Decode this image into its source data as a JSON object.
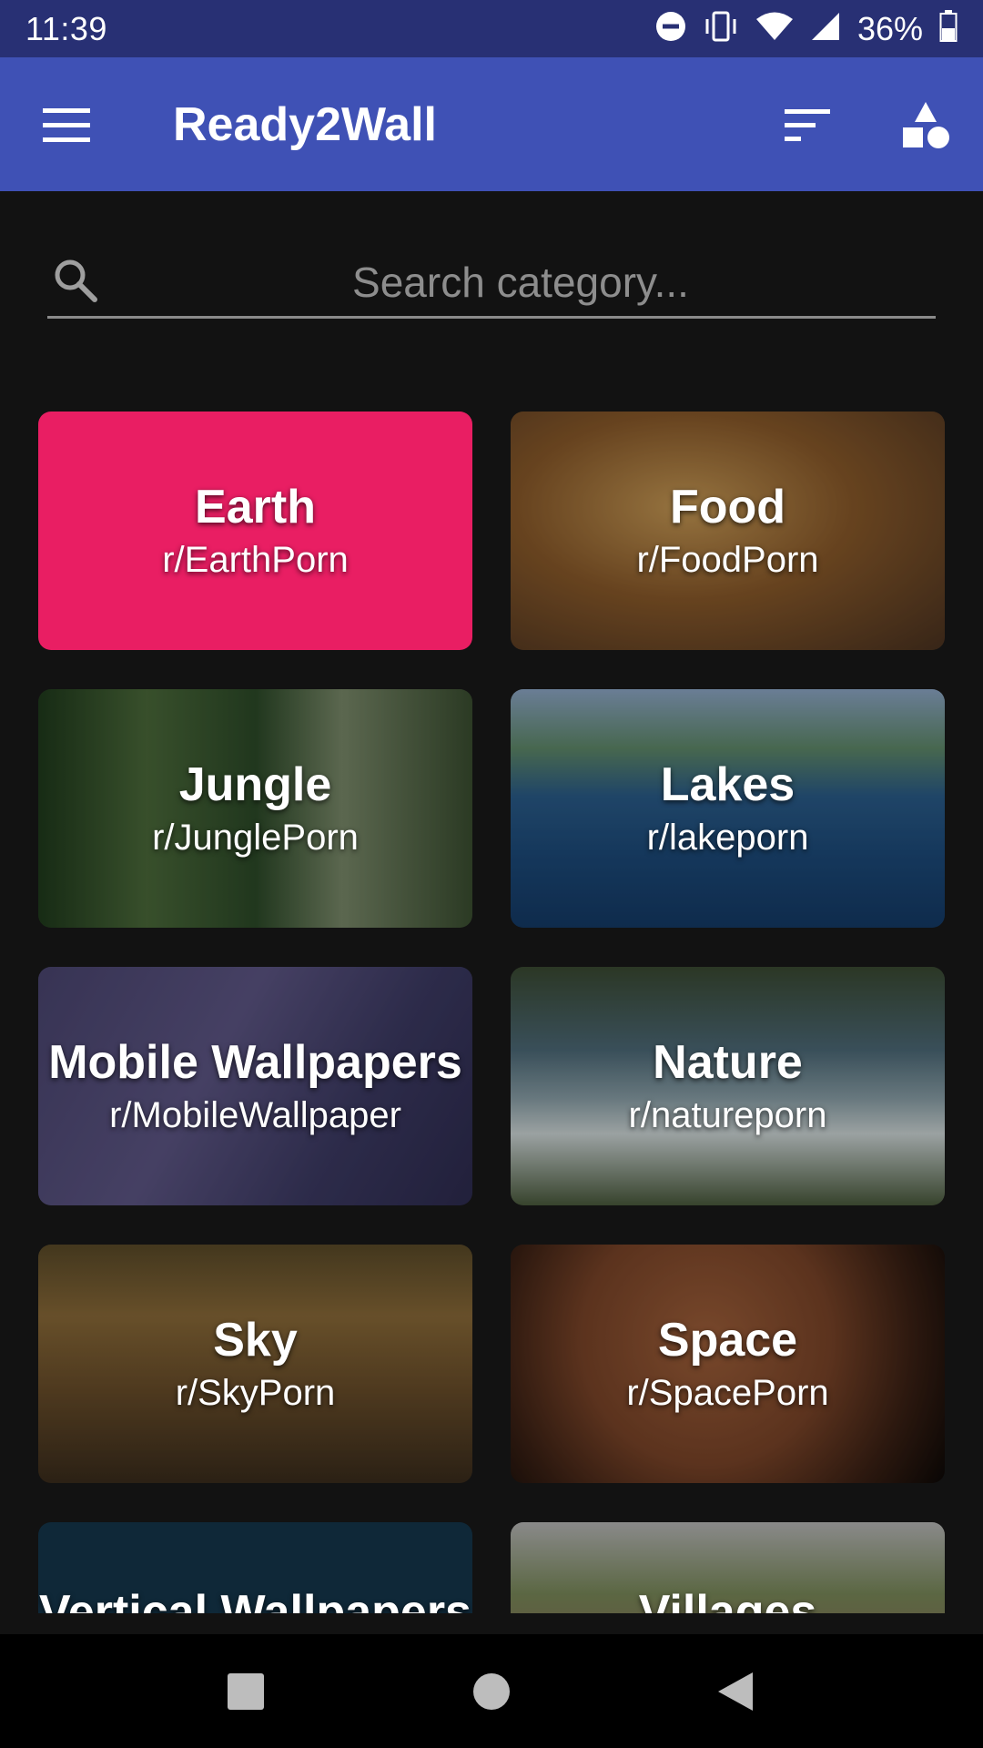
{
  "status_bar": {
    "time": "11:39",
    "battery_percent": "36%",
    "icons": [
      "do-not-disturb-icon",
      "vibrate-icon",
      "wifi-icon",
      "cellular-signal-icon",
      "battery-icon"
    ]
  },
  "app_bar": {
    "title": "Ready2Wall",
    "menu_icon": "hamburger-menu-icon",
    "sort_icon": "sort-icon",
    "shapes_icon": "shapes-icon",
    "background_color": "#3f51b5"
  },
  "search": {
    "placeholder": "Search category...",
    "value": ""
  },
  "categories": [
    {
      "title": "Earth",
      "subreddit": "r/EarthPorn",
      "accent": "#e91e63"
    },
    {
      "title": "Food",
      "subreddit": "r/FoodPorn"
    },
    {
      "title": "Jungle",
      "subreddit": "r/JunglePorn"
    },
    {
      "title": "Lakes",
      "subreddit": "r/lakeporn"
    },
    {
      "title": "Mobile Wallpapers",
      "subreddit": "r/MobileWallpaper"
    },
    {
      "title": "Nature",
      "subreddit": "r/natureporn"
    },
    {
      "title": "Sky",
      "subreddit": "r/SkyPorn"
    },
    {
      "title": "Space",
      "subreddit": "r/SpacePorn"
    },
    {
      "title": "Vertical Wallpapers",
      "subreddit": ""
    },
    {
      "title": "Villages",
      "subreddit": ""
    }
  ],
  "nav_bar": {
    "icons": [
      "recents-square-icon",
      "home-circle-icon",
      "back-triangle-icon"
    ]
  }
}
